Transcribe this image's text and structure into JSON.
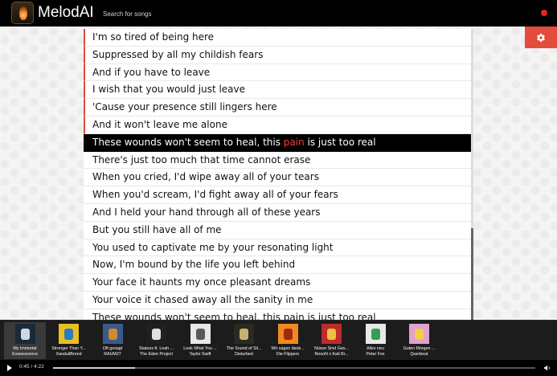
{
  "app": {
    "title": "MelodAI"
  },
  "search": {
    "placeholder": "Search for songs"
  },
  "lyrics": [
    {
      "text": "I'm so tired of being here",
      "state": "past"
    },
    {
      "text": "Suppressed by all my childish fears",
      "state": "past"
    },
    {
      "text": "And if you have to leave",
      "state": "past"
    },
    {
      "text": "I wish that you would just leave",
      "state": "past"
    },
    {
      "text": "'Cause your presence still lingers here",
      "state": "past"
    },
    {
      "text": "And it won't leave me alone",
      "state": "past"
    },
    {
      "text": "These wounds won't seem to heal, this ",
      "highlight": "pain",
      "after": " is just too real",
      "state": "current"
    },
    {
      "text": "There's just too much that time cannot erase",
      "state": "future"
    },
    {
      "text": "When you cried, I'd wipe away all of your tears",
      "state": "future"
    },
    {
      "text": "When you'd scream, I'd fight away all of your fears",
      "state": "future"
    },
    {
      "text": "And I held your hand through all of these years",
      "state": "future"
    },
    {
      "text": "But you still have all of me",
      "state": "future"
    },
    {
      "text": "You used to captivate me by your resonating light",
      "state": "future"
    },
    {
      "text": "Now, I'm bound by the life you left behind",
      "state": "future"
    },
    {
      "text": "Your face it haunts my once pleasant dreams",
      "state": "future"
    },
    {
      "text": "Your voice it chased away all the sanity in me",
      "state": "future"
    },
    {
      "text": "These wounds won't seem to heal, this pain is just too real",
      "state": "future"
    }
  ],
  "playlist": [
    {
      "title": "My Immortal",
      "artist": "Evanescence",
      "active": true,
      "cover": [
        "#1a2a3a",
        "#cfd8e0"
      ]
    },
    {
      "title": "Stronger Than Y...",
      "artist": "XanduitBored",
      "active": false,
      "cover": [
        "#e8c020",
        "#2a7ac0"
      ]
    },
    {
      "title": "Oft gesagt",
      "artist": "RAUM27",
      "active": false,
      "cover": [
        "#3a5a8a",
        "#d08a30"
      ]
    },
    {
      "title": "Statues ft. Leah ...",
      "artist": "The Eden Project",
      "active": false,
      "cover": [
        "#202020",
        "#e0e0e0"
      ]
    },
    {
      "title": "Look What You ...",
      "artist": "Taylor Swift",
      "active": false,
      "cover": [
        "#e8e8e8",
        "#5a5a5a"
      ]
    },
    {
      "title": "The Sound of Sil...",
      "artist": "Disturbed",
      "active": false,
      "cover": [
        "#2a2a20",
        "#c8b070"
      ]
    },
    {
      "title": "Wir sagen dank...",
      "artist": "Die Flippers",
      "active": false,
      "cover": [
        "#f08a20",
        "#a02a10"
      ]
    },
    {
      "title": "Nüsse Sind Ges...",
      "artist": "NoooN x Kati Br...",
      "active": false,
      "cover": [
        "#c02a2a",
        "#f0c040"
      ]
    },
    {
      "title": "Alles neu",
      "artist": "Peter Fox",
      "active": false,
      "cover": [
        "#e8e8e8",
        "#30a050"
      ]
    },
    {
      "title": "Guten Morgen ...",
      "artist": "Querbeat",
      "active": false,
      "cover": [
        "#e0a0d0",
        "#f0d040"
      ]
    }
  ],
  "player": {
    "time": "0:45 / 4:22",
    "progress": 0.17
  },
  "colors": {
    "accent": "#e34b3b",
    "highlight": "#ff3b2f",
    "bar": "#000000"
  },
  "icons": {
    "settings": "gear-icon",
    "play": "play-icon",
    "volume": "volume-icon"
  }
}
